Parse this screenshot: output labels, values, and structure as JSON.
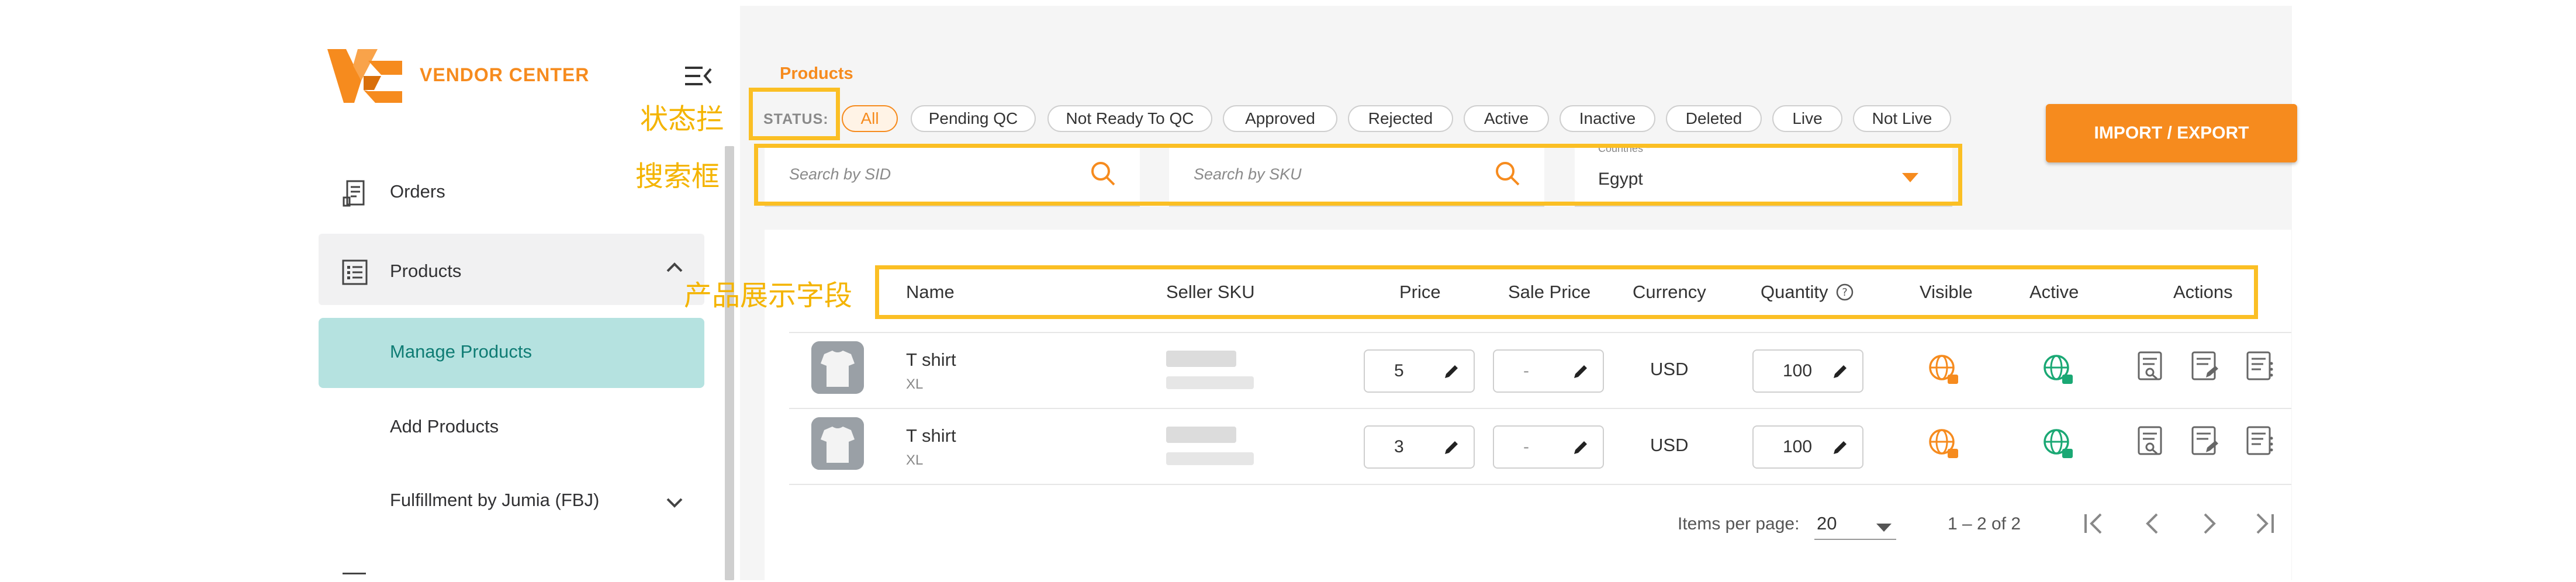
{
  "brand": {
    "logo_text": "VENDOR CENTER"
  },
  "sidebar": {
    "items": [
      {
        "label": "Orders"
      },
      {
        "label": "Products"
      },
      {
        "label": "Manage Products"
      },
      {
        "label": "Add Products"
      },
      {
        "label": "Fulfillment by Jumia (FBJ)"
      }
    ]
  },
  "page": {
    "title": "Products",
    "status_label": "STATUS:"
  },
  "status_filters": [
    "All",
    "Pending QC",
    "Not Ready To QC",
    "Approved",
    "Rejected",
    "Active",
    "Inactive",
    "Deleted",
    "Live",
    "Not Live"
  ],
  "search": {
    "sid_placeholder": "Search by SID",
    "sku_placeholder": "Search by SKU",
    "countries_label": "Countries *",
    "countries_value": "Egypt"
  },
  "import_export_label": "IMPORT / EXPORT",
  "table": {
    "headers": [
      "Name",
      "Seller SKU",
      "Price",
      "Sale Price",
      "Currency",
      "Quantity",
      "Visible",
      "Active",
      "Actions"
    ],
    "rows": [
      {
        "name": "T shirt",
        "variant": "XL",
        "price": "5",
        "sale_price": "-",
        "currency": "USD",
        "quantity": "100"
      },
      {
        "name": "T shirt",
        "variant": "XL",
        "price": "3",
        "sale_price": "-",
        "currency": "USD",
        "quantity": "100"
      }
    ]
  },
  "pagination": {
    "items_per_page_label": "Items per page:",
    "items_per_page_value": "20",
    "range": "1 – 2 of 2"
  },
  "annotations": {
    "status_bar": "状态拦",
    "search_box": "搜索框",
    "product_fields": "产品展示字段"
  },
  "colors": {
    "accent": "#f68b1e",
    "annotation": "#fbbf24",
    "active_nav": "#b5e2e0",
    "globe_green": "#1aa874"
  }
}
